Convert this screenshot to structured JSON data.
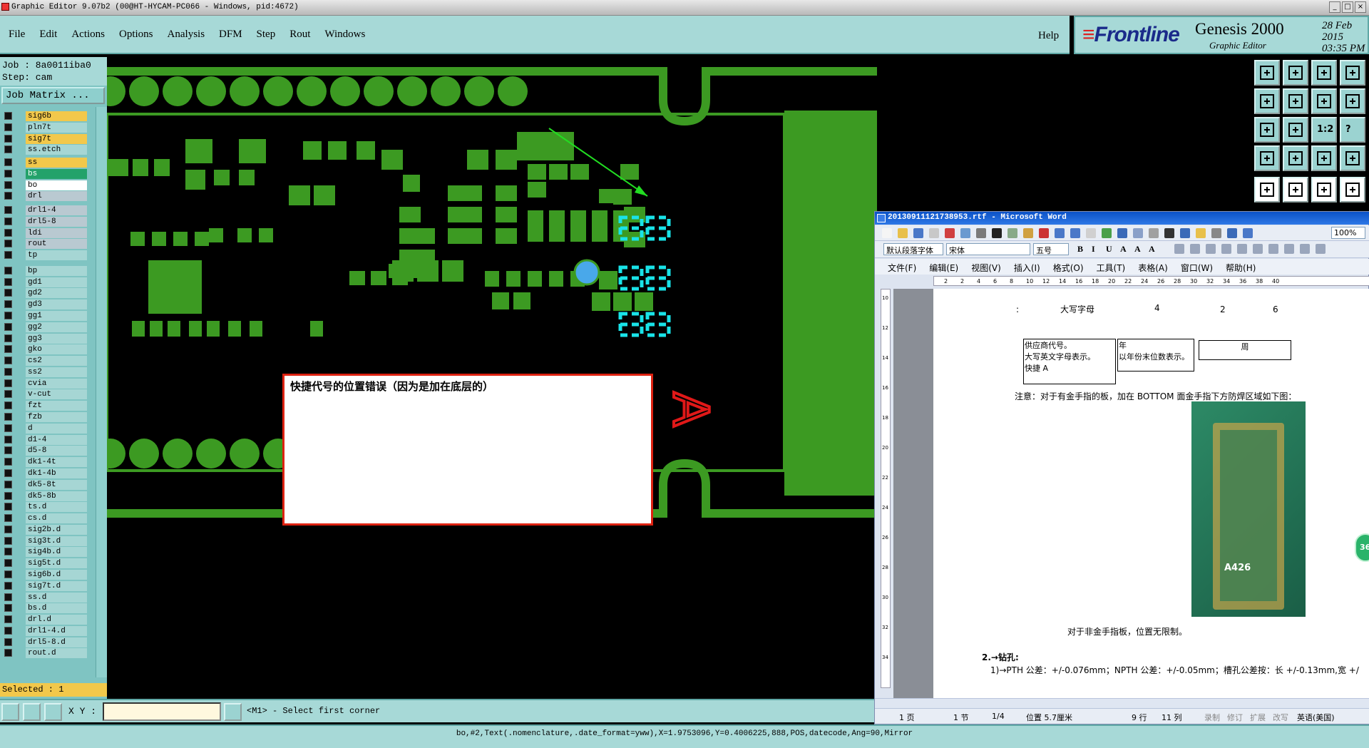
{
  "window": {
    "title": "Graphic Editor 9.07b2 (00@HT-HYCAM-PC066 - Windows, pid:4672)"
  },
  "menu": [
    "File",
    "Edit",
    "Actions",
    "Options",
    "Analysis",
    "DFM",
    "Step",
    "Rout",
    "Windows"
  ],
  "help_label": "Help",
  "brand": {
    "logo": "Frontline",
    "product": "Genesis 2000",
    "subtitle": "Graphic Editor",
    "date": "28 Feb 2015",
    "time": "03:35 PM"
  },
  "job": {
    "job_line": "Job : 8a0011iba0",
    "step_line": "Step: cam",
    "matrix_button": "Job Matrix ..."
  },
  "layers": [
    {
      "name": "sig6b",
      "style": "yellow"
    },
    {
      "name": "pln7t",
      "style": ""
    },
    {
      "name": "sig7t",
      "style": "yellow"
    },
    {
      "name": "ss.etch",
      "style": ""
    },
    {
      "name": "ss",
      "style": "yellow"
    },
    {
      "name": "bs",
      "style": "green"
    },
    {
      "name": "bo",
      "style": "white"
    },
    {
      "name": "drl",
      "style": "grey"
    },
    {
      "name": "drl1-4",
      "style": "grey"
    },
    {
      "name": "drl5-8",
      "style": "grey"
    },
    {
      "name": "ldi",
      "style": "grey"
    },
    {
      "name": "rout",
      "style": "grey"
    },
    {
      "name": "tp",
      "style": ""
    },
    {
      "name": "bp",
      "style": ""
    },
    {
      "name": "gd1",
      "style": ""
    },
    {
      "name": "gd2",
      "style": ""
    },
    {
      "name": "gd3",
      "style": ""
    },
    {
      "name": "gg1",
      "style": ""
    },
    {
      "name": "gg2",
      "style": ""
    },
    {
      "name": "gg3",
      "style": ""
    },
    {
      "name": "gko",
      "style": ""
    },
    {
      "name": "cs2",
      "style": ""
    },
    {
      "name": "ss2",
      "style": ""
    },
    {
      "name": "cvia",
      "style": ""
    },
    {
      "name": "v-cut",
      "style": ""
    },
    {
      "name": "fzt",
      "style": ""
    },
    {
      "name": "fzb",
      "style": ""
    },
    {
      "name": "d",
      "style": ""
    },
    {
      "name": "d1-4",
      "style": ""
    },
    {
      "name": "d5-8",
      "style": ""
    },
    {
      "name": "dk1-4t",
      "style": ""
    },
    {
      "name": "dk1-4b",
      "style": ""
    },
    {
      "name": "dk5-8t",
      "style": ""
    },
    {
      "name": "dk5-8b",
      "style": ""
    },
    {
      "name": "ts.d",
      "style": ""
    },
    {
      "name": "cs.d",
      "style": ""
    },
    {
      "name": "sig2b.d",
      "style": ""
    },
    {
      "name": "sig3t.d",
      "style": ""
    },
    {
      "name": "sig4b.d",
      "style": ""
    },
    {
      "name": "sig5t.d",
      "style": ""
    },
    {
      "name": "sig6b.d",
      "style": ""
    },
    {
      "name": "sig7t.d",
      "style": ""
    },
    {
      "name": "ss.d",
      "style": ""
    },
    {
      "name": "bs.d",
      "style": ""
    },
    {
      "name": "drl.d",
      "style": ""
    },
    {
      "name": "drl1-4.d",
      "style": ""
    },
    {
      "name": "drl5-8.d",
      "style": ""
    },
    {
      "name": "rout.d",
      "style": ""
    }
  ],
  "selected_label": "Selected : 1",
  "xy_label": "X Y :",
  "xy_value": "",
  "prompt": "<M1> - Select first corner",
  "status_line": "bo,#2,Text(.nomenclature,.date_format=yww),X=1.9753096,Y=0.4006225,888,POS,datecode,Ang=90,Mirror",
  "annotation": "快捷代号的位置错误（因为是加在底层的）",
  "board_text": "A",
  "toolbox_icon_labels": [
    "1:2",
    "?"
  ],
  "word": {
    "title": "20130911121738953.rtf - Microsoft Word",
    "style_box": "默认段落字体",
    "font_box": "宋体",
    "size_box": "五号",
    "zoom": "100%",
    "menu": [
      "文件(F)",
      "编辑(E)",
      "视图(V)",
      "插入(I)",
      "格式(O)",
      "工具(T)",
      "表格(A)",
      "窗口(W)",
      "帮助(H)"
    ],
    "ruler_ticks": [
      "2",
      "2",
      "4",
      "6",
      "8",
      "10",
      "12",
      "14",
      "16",
      "18",
      "20",
      "22",
      "24",
      "26",
      "28",
      "30",
      "32",
      "34",
      "36",
      "38",
      "40"
    ],
    "vruler_ticks": [
      "10",
      "12",
      "14",
      "16",
      "18",
      "20",
      "22",
      "24",
      "26",
      "28",
      "30",
      "32",
      "34"
    ],
    "doc": {
      "colon": ":",
      "label_upper": "大写字母",
      "label_4": "4",
      "label_2": "2",
      "label_6": "6",
      "box1": [
        "供应商代号。",
        "大写英文字母表示。",
        "快捷 A"
      ],
      "box2": [
        "年",
        "以年份末位数表示。"
      ],
      "box3": "周",
      "note_line": "注意：对于有金手指的板，加在 BOTTOM 面金手指下方防焊区域如下图：",
      "photo_label": "A426",
      "non_gold_line": "对于非金手指板，位置无限制。",
      "section_heading": "2.→钻孔:",
      "tolerance_line": "1)→PTH 公差：+/-0.076mm；NPTH 公差：+/-0.05mm；槽孔公差按：长 +/-0.13mm,宽 +/"
    },
    "status": {
      "page": "1 页",
      "section": "1 节",
      "pages": "1/4",
      "pos": "位置 5.7厘米",
      "row": "9 行",
      "col": "11 列",
      "rec": "录制",
      "trk": "修订",
      "ext": "扩展",
      "ovr": "改写",
      "lang": "英语(美国)"
    }
  },
  "side_badge": "36",
  "colors": {
    "panel": "#a7d9d7",
    "copper": "#3c9a22",
    "annotation_border": "#d21",
    "silk_cyan": "#19e3e8",
    "silk_red": "#e01818",
    "arrow": "#22dd22"
  }
}
